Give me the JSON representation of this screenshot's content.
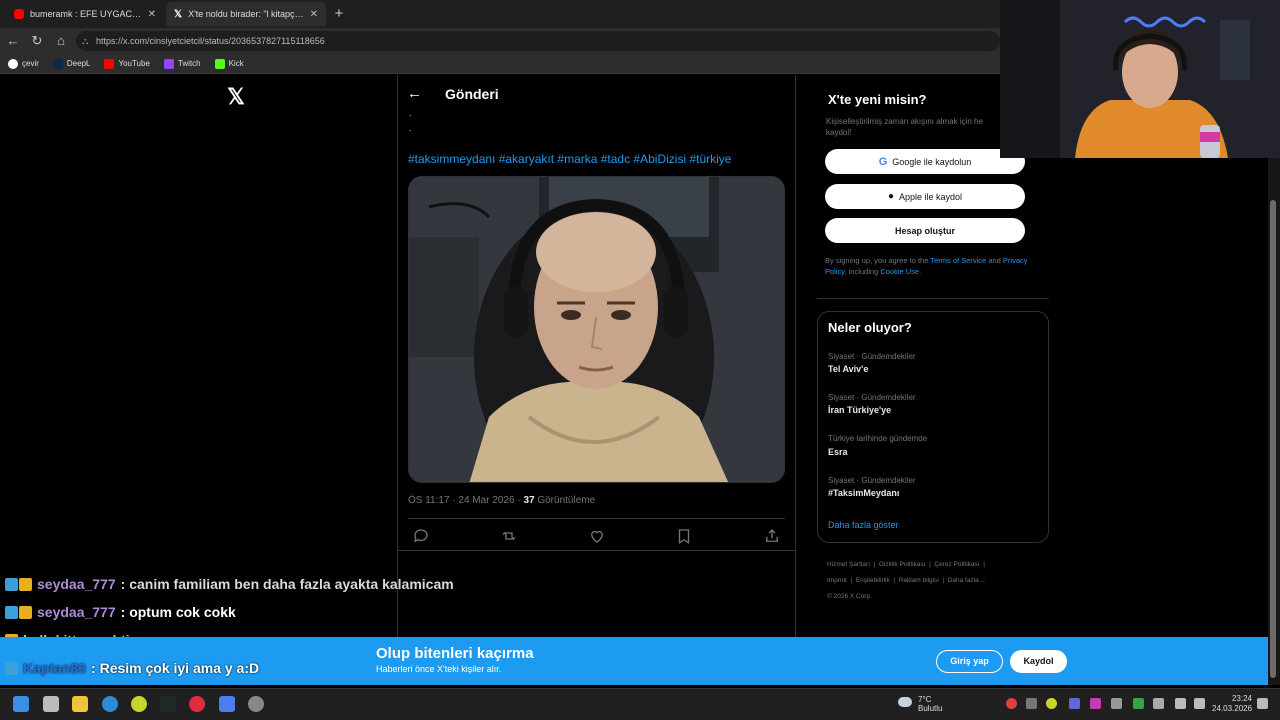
{
  "browser": {
    "tabs": [
      {
        "title": "bumeramk : EFE UYGAC AKIMI TE",
        "close": "✕"
      },
      {
        "title": "X'te noldu birader: \"l kitapçığı . . .",
        "close": "✕"
      }
    ],
    "new_tab": "+",
    "url": "https://x.com/cinsiyetcietcil/status/2036537827115118656",
    "bookmarks": [
      "çevir",
      "DeepL",
      "YouTube",
      "Twitch",
      "Kick"
    ]
  },
  "post": {
    "header_title": "Gönderi",
    "dots": [
      ".",
      "."
    ],
    "hashtags": "#taksimmeydanı #akaryakıt #marka #tadc #AbiDizisi #türkiye",
    "time": "ÖS 11:17 · 24 Mar 2026 ·",
    "views_count": "37",
    "views_label": "Görüntüleme"
  },
  "signup": {
    "title": "X'te yeni misin?",
    "subtitle": "Kişiselleştirilmiş zaman akışını almak için he kaydol!",
    "google_label": "Google ile kaydolun",
    "apple_label": "Apple ile kaydol",
    "create_label": "Hesap oluştur",
    "terms_pre": "By signing up, you agree to the",
    "terms_tos": "Terms of Service",
    "terms_and": "and",
    "terms_privacy": "Privacy Policy",
    "terms_including": ", including",
    "terms_cookie": "Cookie Use."
  },
  "trends": {
    "title": "Neler oluyor?",
    "items": [
      {
        "category": "Siyaset · Gündemdekiler",
        "name": "Tel Aviv'e"
      },
      {
        "category": "Siyaset · Gündemdekiler",
        "name": "İran Türkiye'ye"
      },
      {
        "category": "Türkiye tarihinde gündemde",
        "name": "Esra"
      },
      {
        "category": "Siyaset · Gündemdekiler",
        "name": "#TaksimMeydanı"
      }
    ],
    "more": "Daha fazla göster"
  },
  "footer": {
    "links": [
      "Hizmet Şartları",
      "Gizlilik Politikası",
      "Çerez Politikası",
      "Imprint",
      "Erişilebilirlik",
      "Reklam bilgisi",
      "Daha fazla ..."
    ],
    "copyright": "© 2026 X Corp."
  },
  "chat": [
    {
      "user": "seydaa_777",
      "message": ": canim familiam ben daha fazla ayakta kalamicam",
      "user_color": "#b08ad6",
      "msg_color": "#d9d9d9"
    },
    {
      "user": "seydaa_777",
      "message": ": optum cok cokk",
      "user_color": "#b08ad6",
      "msg_color": "#ffffff"
    },
    {
      "user": "hellokitty_mehti",
      "message": ": nereye",
      "user_color": "#7ee07e",
      "msg_color": "#ffffff"
    },
    {
      "user": "Kaptan80",
      "message": ": Resim çok iyi ama y a:D",
      "user_color": "#2a6fd6",
      "msg_color": "#ffffff"
    }
  ],
  "banner": {
    "title": "Olup bitenleri kaçırma",
    "subtitle": "Haberleri önce X'teki kişiler alır.",
    "login": "Giriş yap",
    "signup": "Kaydol"
  },
  "taskbar": {
    "temperature": "7°C",
    "weather": "Bulutlu",
    "time": "23:24",
    "date": "24.03.2026"
  },
  "colors": {
    "accent": "#1d9bf0",
    "background": "#000000",
    "border": "#2f3336"
  }
}
